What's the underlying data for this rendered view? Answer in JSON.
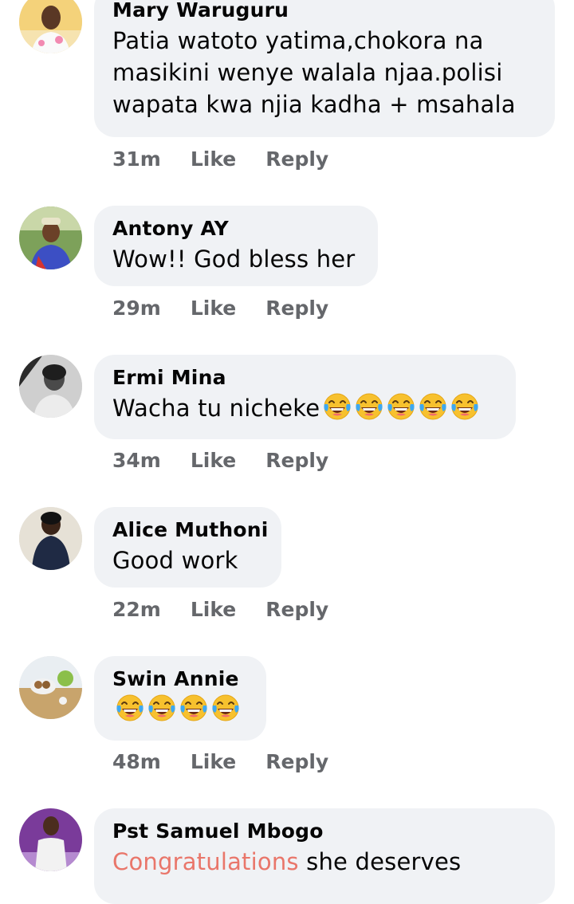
{
  "comments": [
    {
      "author": "Mary Waruguru",
      "lines": [
        "Patia watoto yatima,chokora na",
        "masikini wenye walala njaa.polisi",
        "wapata kwa njia kadha + msahala"
      ],
      "time": "31m",
      "like": "Like",
      "reply": "Reply",
      "avatar_icon": "woman-in-white-avatar"
    },
    {
      "author": "Antony AY",
      "text": "Wow!! God bless her",
      "time": "29m",
      "like": "Like",
      "reply": "Reply",
      "avatar_icon": "man-outdoor-avatar"
    },
    {
      "author": "Ermi Mina",
      "text": "Wacha tu nicheke",
      "emoji_count": 5,
      "time": "34m",
      "like": "Like",
      "reply": "Reply",
      "avatar_icon": "grayscale-woman-avatar"
    },
    {
      "author": "Alice Muthoni",
      "text": "Good work",
      "time": "22m",
      "like": "Like",
      "reply": "Reply",
      "avatar_icon": "woman-dark-dress-avatar"
    },
    {
      "author": "Swin Annie",
      "emoji_count": 4,
      "time": "48m",
      "like": "Like",
      "reply": "Reply",
      "avatar_icon": "food-plate-avatar"
    },
    {
      "author": "Pst Samuel Mbogo",
      "highlight": "Congratulations",
      "text": " she deserves",
      "avatar_icon": "man-purple-background-avatar"
    }
  ],
  "emoji_icon": "tears-of-joy-emoji",
  "colors": {
    "bubble": "#f0f2f5",
    "meta_text": "#65676b",
    "highlight": "#e9766a"
  }
}
